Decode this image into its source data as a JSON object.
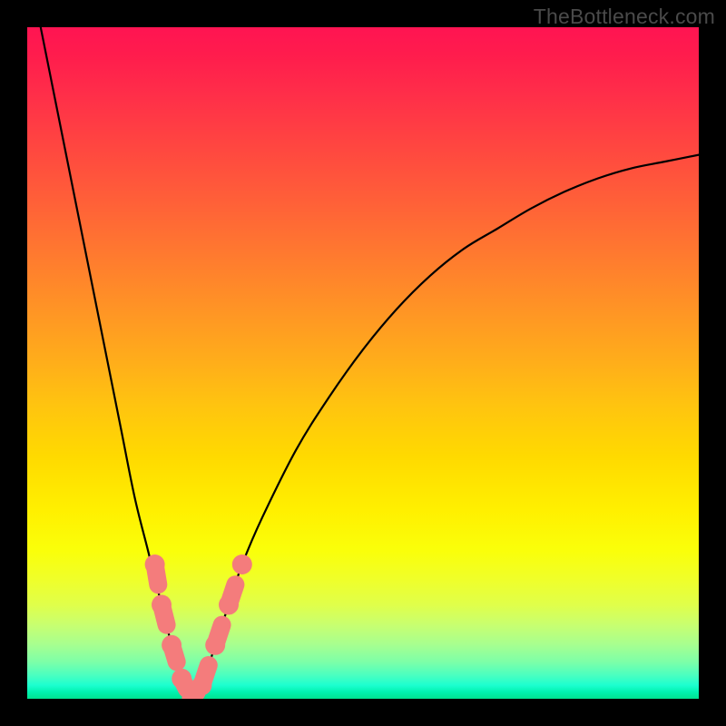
{
  "watermark": "TheBottleneck.com",
  "chart_data": {
    "type": "line",
    "title": "",
    "xlabel": "",
    "ylabel": "",
    "xlim": [
      0,
      1
    ],
    "ylim": [
      0,
      1
    ],
    "grid": false,
    "series": [
      {
        "name": "curve",
        "color": "#000000",
        "x": [
          0.02,
          0.04,
          0.06,
          0.08,
          0.1,
          0.12,
          0.14,
          0.16,
          0.18,
          0.2,
          0.215,
          0.23,
          0.245,
          0.26,
          0.28,
          0.3,
          0.32,
          0.35,
          0.4,
          0.45,
          0.5,
          0.55,
          0.6,
          0.65,
          0.7,
          0.75,
          0.8,
          0.85,
          0.9,
          0.95,
          1.0
        ],
        "y": [
          1.0,
          0.9,
          0.8,
          0.7,
          0.6,
          0.5,
          0.4,
          0.3,
          0.22,
          0.14,
          0.08,
          0.03,
          0.0,
          0.02,
          0.08,
          0.14,
          0.2,
          0.27,
          0.37,
          0.45,
          0.52,
          0.58,
          0.63,
          0.67,
          0.7,
          0.73,
          0.755,
          0.775,
          0.79,
          0.8,
          0.81
        ]
      },
      {
        "name": "markers",
        "color": "#f47c7c",
        "x": [
          0.19,
          0.2,
          0.215,
          0.23,
          0.245,
          0.26,
          0.28,
          0.3,
          0.32
        ],
        "y": [
          0.2,
          0.14,
          0.08,
          0.03,
          0.0,
          0.02,
          0.08,
          0.14,
          0.2
        ]
      }
    ],
    "annotations": []
  }
}
